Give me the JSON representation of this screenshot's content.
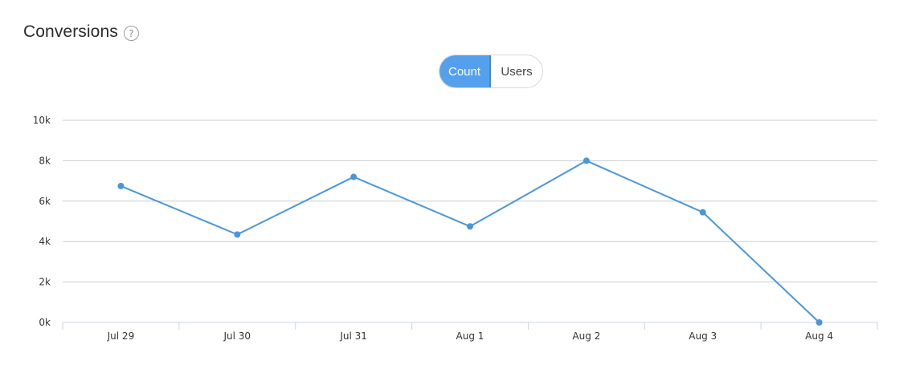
{
  "header": {
    "title": "Conversions",
    "help": "?"
  },
  "toggle": {
    "options": [
      "Count",
      "Users"
    ],
    "active": "Count"
  },
  "colors": {
    "line": "#4a97d8",
    "grid": "#c8ccd0",
    "toggle_active": "#55a0ec"
  },
  "chart_data": {
    "type": "line",
    "categories": [
      "Jul 29",
      "Jul 30",
      "Jul 31",
      "Aug 1",
      "Aug 2",
      "Aug 3",
      "Aug 4"
    ],
    "series": [
      {
        "values": [
          6750,
          4350,
          7200,
          4750,
          8000,
          5450,
          0
        ]
      }
    ],
    "yticks": [
      "0k",
      "2k",
      "4k",
      "6k",
      "8k",
      "10k"
    ],
    "ylim": [
      0,
      10000
    ],
    "grid": true,
    "legend": "none"
  }
}
